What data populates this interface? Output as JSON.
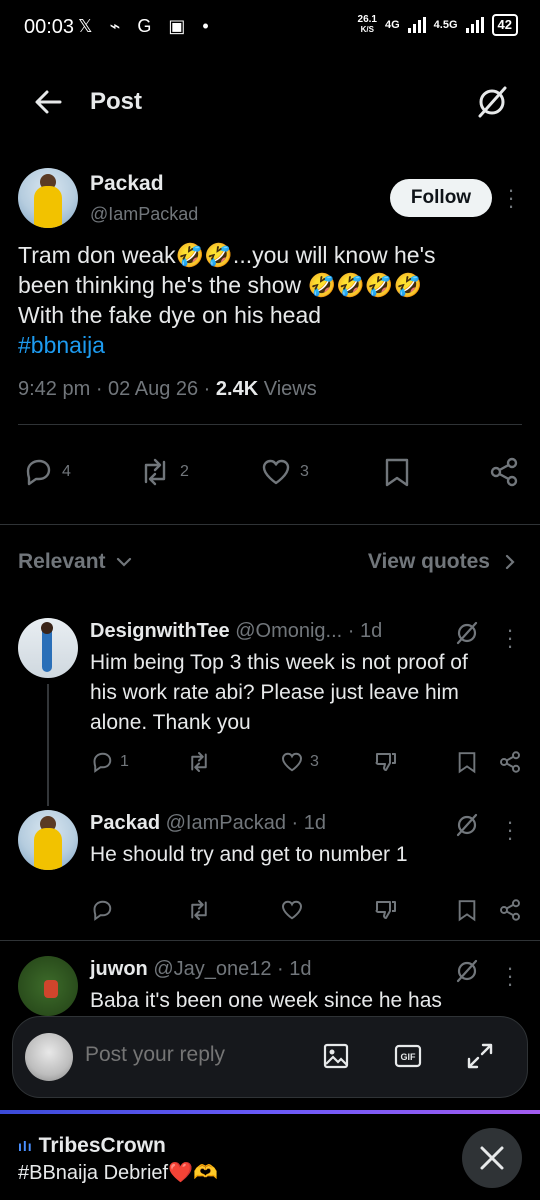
{
  "status_bar": {
    "time": "00:03",
    "icons": [
      "x-logo",
      "cast-icon",
      "G",
      "app-icon",
      "dot"
    ],
    "speed": "26.1",
    "speed_unit": "K/S",
    "net1": "4G",
    "net2": "4.5G",
    "battery": "42"
  },
  "header": {
    "title": "Post"
  },
  "post": {
    "author_name": "Packad",
    "author_handle": "@IamPackad",
    "follow_label": "Follow",
    "text_line1": "Tram don weak🤣🤣...you will know he's",
    "text_line2": "been thinking he's the show 🤣🤣🤣🤣",
    "text_line3": "With the fake dye on his head",
    "hashtag": "#bbnaija",
    "meta_time": "9:42 pm · 02 Aug 26 · ",
    "meta_views_count": "2.4K",
    "meta_views_label": " Views",
    "replies": "4",
    "reposts": "2",
    "likes": "3"
  },
  "sort": {
    "relevant_label": "Relevant",
    "view_quotes_label": "View quotes"
  },
  "replies": [
    {
      "name": "DesignwithTee",
      "handle_time": " @Omonig... · 1d",
      "line1": "Him being Top 3 this week is not proof of",
      "line2": "his work rate abi? Please just leave him",
      "line3": "alone. Thank you",
      "replies": "1",
      "likes": "3"
    },
    {
      "name": "Packad",
      "handle_time": " @IamPackad · 1d",
      "line1": "He should try and get to number 1"
    },
    {
      "name": "juwon",
      "handle_time": " @Jay_one12 · 1d",
      "line1": "Baba it's been one week since he has"
    }
  ],
  "compose": {
    "placeholder": "Post your reply"
  },
  "banner": {
    "title": "TribesCrown",
    "subtitle": "#BBnaija Debrief❤️🫶"
  },
  "colors": {
    "accent": "#1d9bf0",
    "muted": "#71767b",
    "text": "#e7e9ea"
  }
}
